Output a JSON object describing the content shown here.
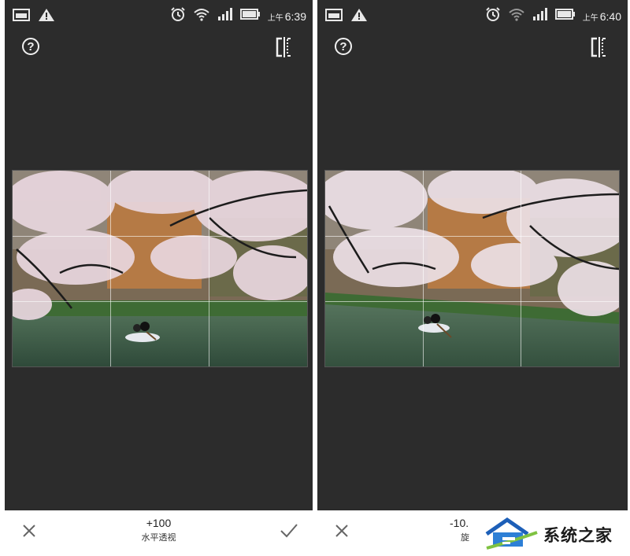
{
  "screens": [
    {
      "status_time_prefix": "上午",
      "status_time": "6:39",
      "help_glyph": "?",
      "adjust_value": "+100",
      "adjust_label": "水平透视"
    },
    {
      "status_time_prefix": "上午",
      "status_time": "6:40",
      "help_glyph": "?",
      "adjust_value": "-10.",
      "adjust_label": "旋"
    }
  ],
  "watermark": {
    "text": "系统之家"
  },
  "icons": {
    "status_left": [
      "image-notification-icon",
      "warning-icon"
    ],
    "status_right": [
      "alarm-icon",
      "wifi-icon",
      "signal-icon",
      "battery-icon"
    ],
    "toolbar": [
      "help-icon",
      "compare-icon"
    ],
    "bottom": [
      "close-icon",
      "check-icon"
    ]
  },
  "colors": {
    "panel_bg": "#2c2c2c",
    "bottom_bg": "#ffffff",
    "status_fg": "#e8e8e8"
  }
}
